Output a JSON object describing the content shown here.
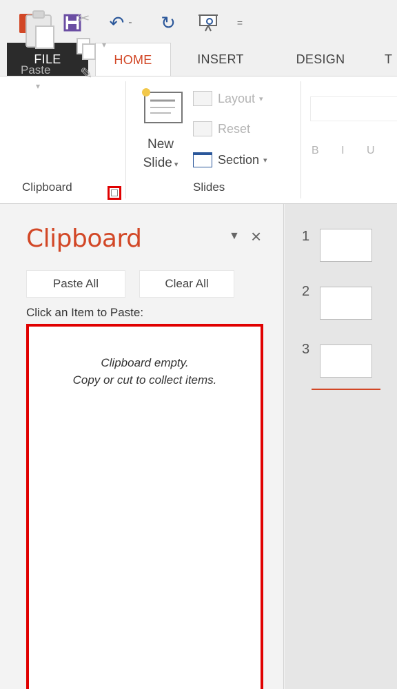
{
  "qat": {
    "logo_text": "P",
    "more_label": "="
  },
  "tabs": {
    "file": "FILE",
    "home": "HOME",
    "insert": "INSERT",
    "design": "DESIGN",
    "next": "T"
  },
  "ribbon": {
    "clipboard_group": {
      "paste_label": "Paste",
      "group_label": "Clipboard"
    },
    "slides_group": {
      "new_slide_line1": "New",
      "new_slide_line2": "Slide",
      "layout_label": "Layout",
      "reset_label": "Reset",
      "section_label": "Section",
      "group_label": "Slides"
    },
    "font_group": {
      "format_buttons": "B I U"
    }
  },
  "clipboard_pane": {
    "title": "Clipboard",
    "paste_all_label": "Paste All",
    "clear_all_label": "Clear All",
    "hint": "Click an Item to Paste:",
    "empty_line1": "Clipboard empty.",
    "empty_line2": "Copy or cut to collect items."
  },
  "thumbnails": {
    "slides": [
      {
        "number": "1"
      },
      {
        "number": "2"
      },
      {
        "number": "3"
      }
    ]
  },
  "colors": {
    "accent": "#d24726",
    "highlight": "#e00000",
    "file_tab": "#2b2b2b"
  }
}
